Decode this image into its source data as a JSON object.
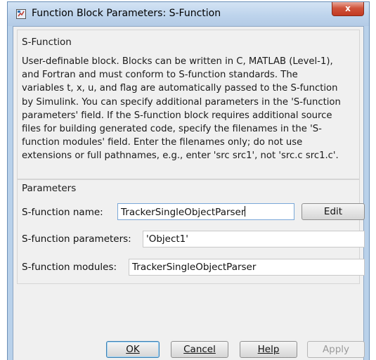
{
  "window": {
    "title": "Function Block Parameters: S-Function",
    "close_glyph": "x"
  },
  "block": {
    "header": "S-Function",
    "description": "User-definable block.  Blocks can be written in C, MATLAB (Level-1),\nand Fortran and must conform to S-function standards.  The\nvariables t, x, u, and flag are automatically passed to the S-function\nby Simulink.  You can specify additional parameters in the 'S-function\nparameters' field. If the S-function block requires additional source\nfiles for building generated code, specify the filenames in the 'S-\nfunction modules' field. Enter the filenames only; do not use\nextensions or full pathnames, e.g., enter 'src src1', not 'src.c src1.c'."
  },
  "parameters": {
    "header": "Parameters",
    "name_label": "S-function name:",
    "name_value": "TrackerSingleObjectParser",
    "edit_label": "Edit",
    "params_label": "S-function parameters:",
    "params_value": "'Object1'",
    "modules_label": "S-function modules:",
    "modules_value": "TrackerSingleObjectParser"
  },
  "buttons": {
    "ok_label": "OK",
    "cancel_label": "Cancel",
    "help_label": "Help",
    "apply_label": "Apply"
  },
  "icons": {
    "title_icon": "simulink-block-icon",
    "close_icon": "close-icon"
  }
}
